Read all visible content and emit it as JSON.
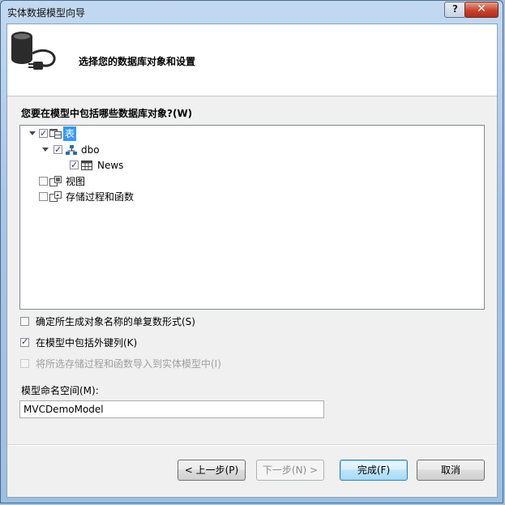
{
  "window": {
    "title": "实体数据模型向导",
    "help_label": "?",
    "close_label": "✕"
  },
  "header": {
    "title": "选择您的数据库对象和设置",
    "icon": "database-connection-icon"
  },
  "objects_label": "您要在模型中包括哪些数据库对象?(W)",
  "tree": {
    "tables": {
      "label": "表",
      "checked": true,
      "expanded": true
    },
    "schema": {
      "label": "dbo",
      "checked": true,
      "expanded": true
    },
    "table_news": {
      "label": "News",
      "checked": true
    },
    "views": {
      "label": "视图",
      "checked": false
    },
    "procs": {
      "label": "存储过程和函数",
      "checked": false
    }
  },
  "options": {
    "pluralize": {
      "label": "确定所生成对象名称的单复数形式(S)",
      "checked": false
    },
    "foreign_keys": {
      "label": "在模型中包括外键列(K)",
      "checked": true
    },
    "import_procs": {
      "label": "将所选存储过程和函数导入到实体模型中(I)",
      "checked": false,
      "enabled": false
    }
  },
  "namespace": {
    "label": "模型命名空间(M):",
    "value": "MVCDemoModel"
  },
  "buttons": {
    "previous": "< 上一步(P)",
    "next": "下一步(N) >",
    "finish": "完成(F)",
    "cancel": "取消"
  },
  "colors": {
    "selection": "#3399ff",
    "titlebar": "#a8c6e6"
  }
}
